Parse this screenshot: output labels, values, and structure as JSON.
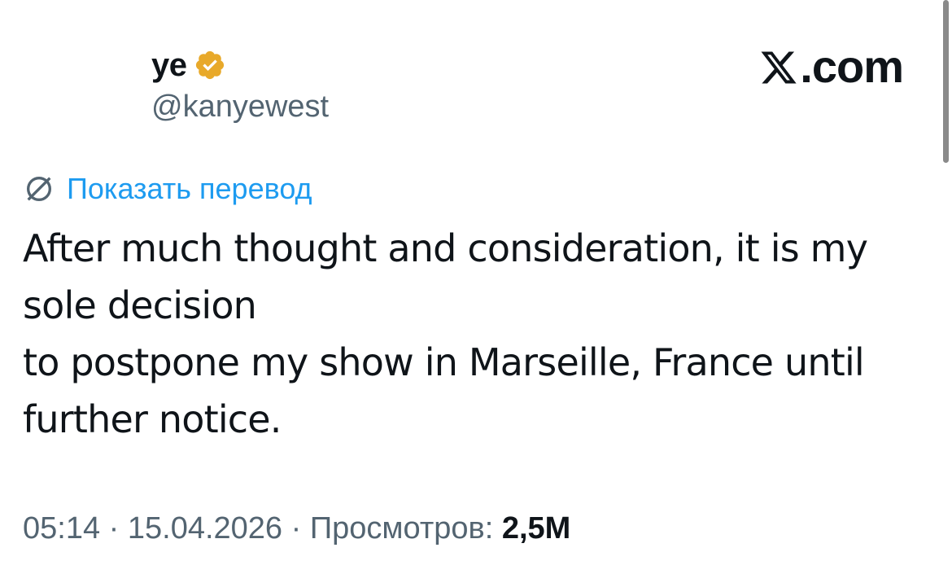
{
  "author": {
    "display_name": "ye",
    "handle": "@kanyewest",
    "verified_badge": "verified-gold-icon"
  },
  "brand": {
    "logo": "x-logo-icon",
    "suffix": ".com"
  },
  "translate": {
    "icon": "globe-icon",
    "label": "Показать перевод"
  },
  "tweet": {
    "lines": [
      "After much thought and consideration, it is my",
      "sole decision",
      "to postpone my show in Marseille, France until",
      "further notice."
    ]
  },
  "meta": {
    "time": "05:14",
    "separator1": " · ",
    "date": "15.04.2026",
    "separator2": " · ",
    "views_label": "Просмотров: ",
    "views_count": "2,5M"
  },
  "colors": {
    "accent": "#1d9bf0",
    "muted": "#536471",
    "text": "#0f1419",
    "badge": "#e8a92a"
  }
}
